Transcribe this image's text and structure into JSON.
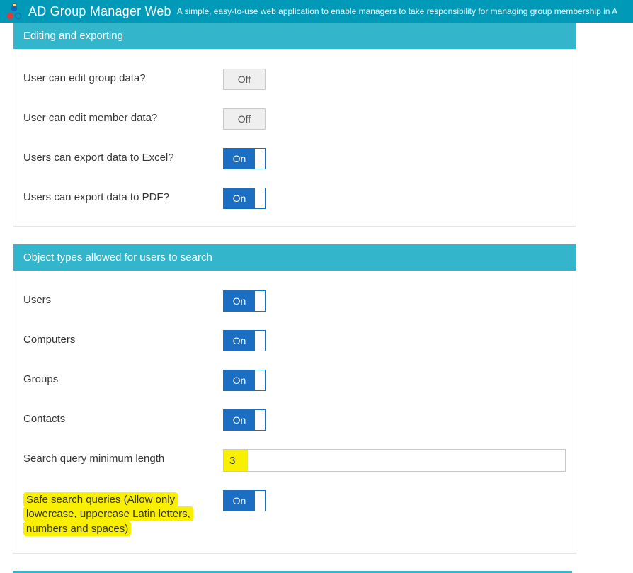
{
  "brand": {
    "title": "AD Group Manager Web",
    "subtitle": "A simple, easy-to-use web application to enable managers to take responsibility for managing group membership in A"
  },
  "panel_editing": {
    "title": "Editing and exporting",
    "rows": [
      {
        "label": "User can edit group data?",
        "state": "off",
        "state_label": "Off"
      },
      {
        "label": "User can edit member data?",
        "state": "off",
        "state_label": "Off"
      },
      {
        "label": "Users can export data to Excel?",
        "state": "on",
        "state_label": "On"
      },
      {
        "label": "Users can export data to PDF?",
        "state": "on",
        "state_label": "On"
      }
    ]
  },
  "panel_search": {
    "title": "Object types allowed for users to search",
    "rows": [
      {
        "label": "Users",
        "state": "on",
        "state_label": "On"
      },
      {
        "label": "Computers",
        "state": "on",
        "state_label": "On"
      },
      {
        "label": "Groups",
        "state": "on",
        "state_label": "On"
      },
      {
        "label": "Contacts",
        "state": "on",
        "state_label": "On"
      }
    ],
    "minlen_label": "Search query minimum length",
    "minlen_value": "3",
    "safe_label": "Safe search queries (Allow only lowercase, uppercase Latin letters, numbers and spaces)",
    "safe_state": "on",
    "safe_state_label": "On"
  }
}
